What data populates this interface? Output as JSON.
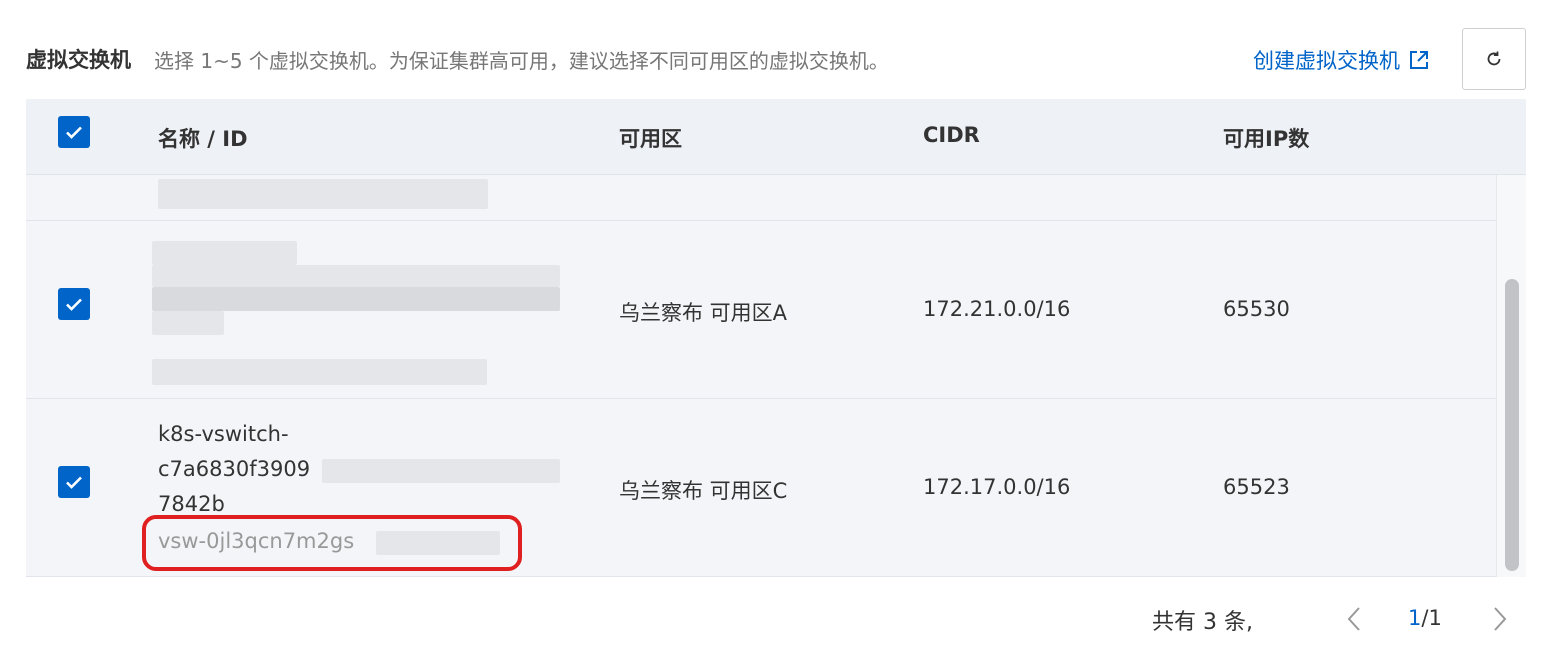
{
  "header": {
    "title": "虚拟交换机",
    "description": "选择 1~5 个虚拟交换机。为保证集群高可用，建议选择不同可用区的虚拟交换机。",
    "create_link": "创建虚拟交换机",
    "create_link_icon": "external-link-icon",
    "refresh_icon": "refresh-icon"
  },
  "table": {
    "columns": [
      "名称 / ID",
      "可用区",
      "CIDR",
      "可用IP数"
    ],
    "select_all_checked": true,
    "rows": [
      {
        "checked": true,
        "name_lines": [],
        "id": "",
        "zone": "乌兰察布 可用区A",
        "cidr": "172.21.0.0/16",
        "available_ips": "65530"
      },
      {
        "checked": true,
        "name_lines": [
          "k8s-vswitch-",
          "c7a6830f3909",
          "7842b"
        ],
        "id": "vsw-0jl3qcn7m2gs",
        "zone": "乌兰察布 可用区C",
        "cidr": "172.17.0.0/16",
        "available_ips": "65523"
      }
    ]
  },
  "footer": {
    "total": "共有 3 条,",
    "current_page": "1",
    "total_pages": "/1"
  },
  "colors": {
    "primary": "#0064c8",
    "highlight": "#e02020"
  }
}
